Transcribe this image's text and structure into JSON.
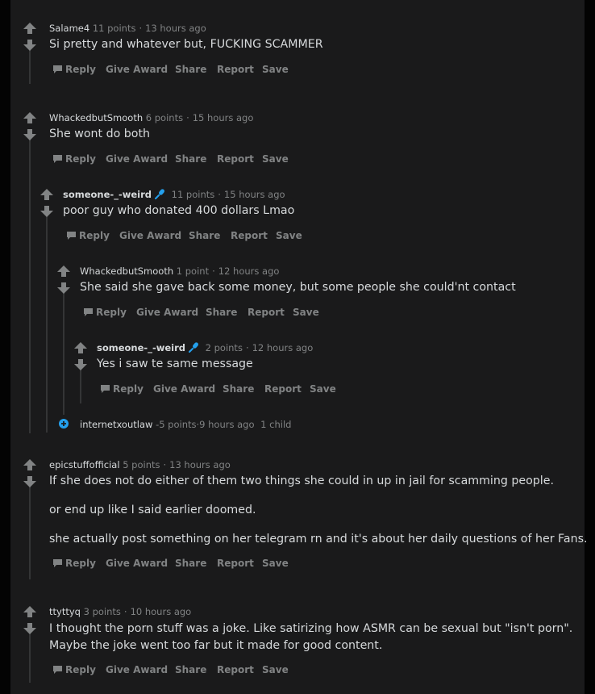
{
  "actions": {
    "reply": "Reply",
    "give_award": "Give Award",
    "share": "Share",
    "report": "Report",
    "save": "Save"
  },
  "comments": [
    {
      "author": "Salame4",
      "points": "11 points",
      "time": "13 hours ago",
      "body": [
        "Si pretty and whatever but, FUCKING SCAMMER"
      ]
    },
    {
      "author": "WhackedbutSmooth",
      "points": "6 points",
      "time": "15 hours ago",
      "body": [
        "She wont do both"
      ]
    },
    {
      "author": "someone-_-weird",
      "points": "11 points",
      "time": "15 hours ago",
      "body": [
        "poor guy who donated 400 dollars Lmao"
      ],
      "flair": "microphone-icon"
    },
    {
      "author": "WhackedbutSmooth",
      "points": "1 point",
      "time": "12 hours ago",
      "body": [
        "She said she gave back some money, but some people she could'nt contact"
      ]
    },
    {
      "author": "someone-_-weird",
      "points": "2 points",
      "time": "12 hours ago",
      "body": [
        "Yes i saw te same message"
      ],
      "flair": "microphone-icon"
    },
    {
      "author": "internetxoutlaw",
      "points": "-5 points",
      "time": "9 hours ago",
      "children": "1 child",
      "collapsed": true
    },
    {
      "author": "epicstuffofficial",
      "points": "5 points",
      "time": "13 hours ago",
      "body": [
        "If she does not do either of them two things she could in up in jail for scamming people.",
        "or end up like I said earlier doomed.",
        "she actually post something on her telegram rn and it's about her daily questions of her Fans."
      ]
    },
    {
      "author": "ttyttyq",
      "points": "3 points",
      "time": "10 hours ago",
      "body": [
        "I thought the porn stuff was a joke. Like satirizing how ASMR can be sexual but \"isn't porn\".",
        "Maybe the joke went too far but it made for good content."
      ]
    }
  ],
  "colors": {
    "panel": "#1a1a1b",
    "page": "#030303",
    "text": "#d7dadc",
    "meta": "#818384",
    "thread": "#343536",
    "accent": "#0079d3",
    "flair": "#24a0ed"
  }
}
